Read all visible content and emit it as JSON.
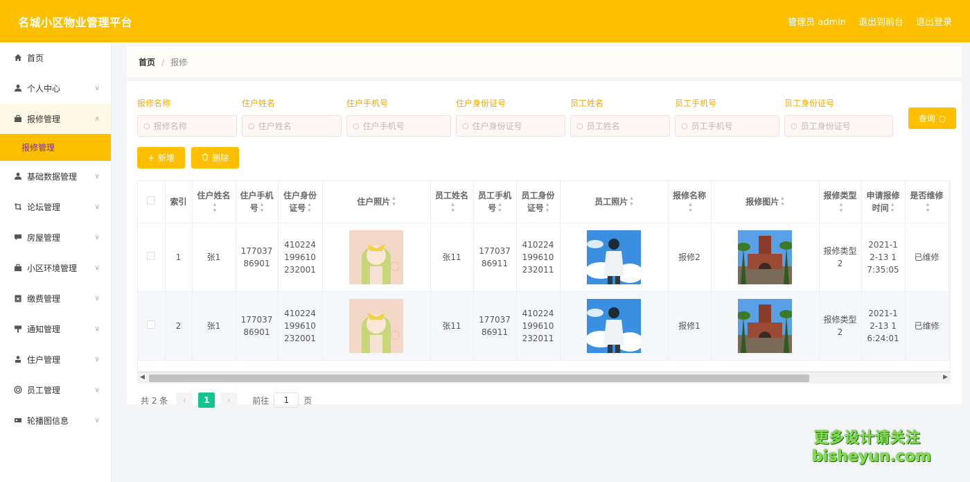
{
  "header": {
    "title": "名城小区物业管理平台",
    "admin_label": "管理员 admin",
    "front_label": "退出到前台",
    "logout_label": "退出登录"
  },
  "sidebar": {
    "items": [
      {
        "label": "首页",
        "icon": "home-icon"
      },
      {
        "label": "个人中心",
        "icon": "user-icon"
      },
      {
        "label": "报修管理",
        "icon": "repair-icon"
      },
      {
        "label": "基础数据管理",
        "icon": "data-icon"
      },
      {
        "label": "论坛管理",
        "icon": "forum-icon"
      },
      {
        "label": "房屋管理",
        "icon": "house-icon"
      },
      {
        "label": "小区环境管理",
        "icon": "environment-icon"
      },
      {
        "label": "缴费管理",
        "icon": "payment-icon"
      },
      {
        "label": "通知管理",
        "icon": "notice-icon"
      },
      {
        "label": "住户管理",
        "icon": "resident-icon"
      },
      {
        "label": "员工管理",
        "icon": "staff-icon"
      },
      {
        "label": "轮播图信息",
        "icon": "carousel-icon"
      }
    ],
    "sub_active": "报修管理"
  },
  "breadcrumb": {
    "home": "首页",
    "sep": "/",
    "current": "报修"
  },
  "filters": [
    {
      "label": "报修名称",
      "placeholder": "报修名称"
    },
    {
      "label": "住户姓名",
      "placeholder": "住户姓名"
    },
    {
      "label": "住户手机号",
      "placeholder": "住户手机号"
    },
    {
      "label": "住户身份证号",
      "placeholder": "住户身份证号"
    },
    {
      "label": "员工姓名",
      "placeholder": "员工姓名"
    },
    {
      "label": "员工手机号",
      "placeholder": "员工手机号"
    },
    {
      "label": "员工身份证号",
      "placeholder": "员工身份证号"
    }
  ],
  "buttons": {
    "query": "查询",
    "add": "新增",
    "delete": "删除"
  },
  "table": {
    "headers": [
      "索引",
      "住户姓名",
      "住户手机号",
      "住户身份证号",
      "住户照片",
      "员工姓名",
      "员工手机号",
      "员工身份证号",
      "员工照片",
      "报修名称",
      "报修图片",
      "报修类型",
      "申请报修时间",
      "是否维修"
    ],
    "rows": [
      {
        "index": "1",
        "resident_name": "张1",
        "resident_phone": "17703786901",
        "resident_id": "410224199610232001",
        "staff_name": "张11",
        "staff_phone": "17703786911",
        "staff_id": "410224199610232011",
        "repair_name": "报修2",
        "repair_type": "报修类型2",
        "time": "2021-12-13 17:35:05",
        "status": "已维修"
      },
      {
        "index": "2",
        "resident_name": "张1",
        "resident_phone": "17703786901",
        "resident_id": "410224199610232001",
        "staff_name": "张11",
        "staff_phone": "17703786911",
        "staff_id": "410224199610232011",
        "repair_name": "报修1",
        "repair_type": "报修类型2",
        "time": "2021-12-13 16:24:01",
        "status": "已维修"
      }
    ]
  },
  "pager": {
    "total": "共 2 条",
    "current": "1",
    "goto_label": "前往",
    "goto_value": "1",
    "page_suffix": "页"
  },
  "watermark": {
    "line1": "更多设计请关注",
    "line2": "bisheyun.com"
  },
  "colors": {
    "primary": "#fdbf00",
    "active_page": "#13c58f",
    "sub_text": "#7a2d9a"
  }
}
